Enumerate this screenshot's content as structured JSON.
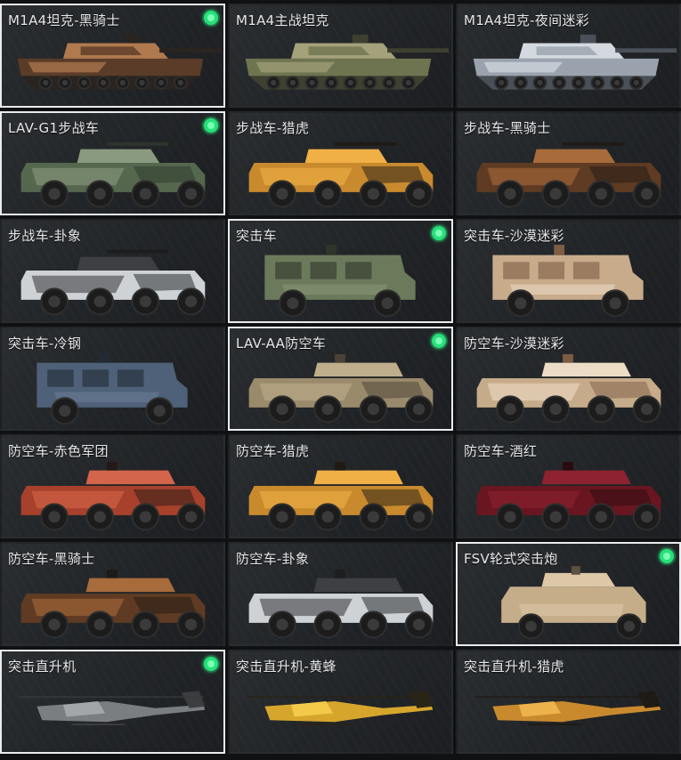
{
  "vehicles": [
    {
      "name": "M1A4坦克-黑骑士",
      "selected": true,
      "owned": true,
      "kind": "tank",
      "colors": [
        "#5a3c28",
        "#b07a4e",
        "#2a2420"
      ]
    },
    {
      "name": "M1A4主战坦克",
      "selected": false,
      "owned": false,
      "kind": "tank",
      "colors": [
        "#6f7450",
        "#a3a27a",
        "#3e4030"
      ]
    },
    {
      "name": "M1A4坦克-夜间迷彩",
      "selected": false,
      "owned": false,
      "kind": "tank",
      "colors": [
        "#9aa3ad",
        "#d3d9de",
        "#4a5058"
      ]
    },
    {
      "name": "LAV-G1步战车",
      "selected": true,
      "owned": true,
      "kind": "ifv",
      "colors": [
        "#55684e",
        "#8a9a80",
        "#2e352c"
      ]
    },
    {
      "name": "步战车-猎虎",
      "selected": false,
      "owned": false,
      "kind": "ifv",
      "colors": [
        "#c98a2e",
        "#f0b046",
        "#1f1a14"
      ]
    },
    {
      "name": "步战车-黑骑士",
      "selected": false,
      "owned": false,
      "kind": "ifv",
      "colors": [
        "#5e3b22",
        "#a86b3c",
        "#1f1a16"
      ]
    },
    {
      "name": "步战车-卦象",
      "selected": false,
      "owned": false,
      "kind": "ifv",
      "colors": [
        "#cfd2d4",
        "#3d3f42",
        "#1c1d1f"
      ]
    },
    {
      "name": "突击车",
      "selected": true,
      "owned": true,
      "kind": "mrap",
      "colors": [
        "#6c7a5c",
        "#8d9a78",
        "#2f3529"
      ]
    },
    {
      "name": "突击车-沙漠迷彩",
      "selected": false,
      "owned": false,
      "kind": "mrap",
      "colors": [
        "#c8ab8a",
        "#efe1d0",
        "#7d5d44"
      ]
    },
    {
      "name": "突击车-冷钢",
      "selected": false,
      "owned": false,
      "kind": "mrap",
      "colors": [
        "#4e6178",
        "#6e829a",
        "#222a33"
      ]
    },
    {
      "name": "LAV-AA防空车",
      "selected": true,
      "owned": true,
      "kind": "aa",
      "colors": [
        "#9a8a6c",
        "#bfae8b",
        "#4a4236"
      ]
    },
    {
      "name": "防空车-沙漠迷彩",
      "selected": false,
      "owned": false,
      "kind": "aa",
      "colors": [
        "#c6ab8a",
        "#ecdcc6",
        "#7b5c43"
      ]
    },
    {
      "name": "防空车-赤色军团",
      "selected": false,
      "owned": false,
      "kind": "aa",
      "colors": [
        "#a8412b",
        "#d3654a",
        "#231a18"
      ]
    },
    {
      "name": "防空车-猎虎",
      "selected": false,
      "owned": false,
      "kind": "aa",
      "colors": [
        "#c98a2e",
        "#f0b046",
        "#1f1a14"
      ]
    },
    {
      "name": "防空车-酒红",
      "selected": false,
      "owned": false,
      "kind": "aa",
      "colors": [
        "#6a1620",
        "#8e2230",
        "#2a0c10"
      ]
    },
    {
      "name": "防空车-黑骑士",
      "selected": false,
      "owned": false,
      "kind": "aa",
      "colors": [
        "#5e3b22",
        "#a86b3c",
        "#1f1a16"
      ]
    },
    {
      "name": "防空车-卦象",
      "selected": false,
      "owned": false,
      "kind": "aa",
      "colors": [
        "#cfd2d4",
        "#3d3f42",
        "#1c1d1f"
      ]
    },
    {
      "name": "FSV轮式突击炮",
      "selected": true,
      "owned": true,
      "kind": "fsv",
      "colors": [
        "#c5ad8a",
        "#dcc7a6",
        "#5c5040"
      ]
    },
    {
      "name": "突击直升机",
      "selected": true,
      "owned": true,
      "kind": "heli",
      "colors": [
        "#7b7e80",
        "#a3a6a8",
        "#3b3d3f"
      ]
    },
    {
      "name": "突击直升机-黄蜂",
      "selected": false,
      "owned": false,
      "kind": "heli",
      "colors": [
        "#d6a62c",
        "#f3c94a",
        "#2a2416"
      ]
    },
    {
      "name": "突击直升机-猎虎",
      "selected": false,
      "owned": false,
      "kind": "heli",
      "colors": [
        "#c98a2e",
        "#eeb24c",
        "#1f1a14"
      ]
    }
  ],
  "owned_icon": "green-dot-icon"
}
